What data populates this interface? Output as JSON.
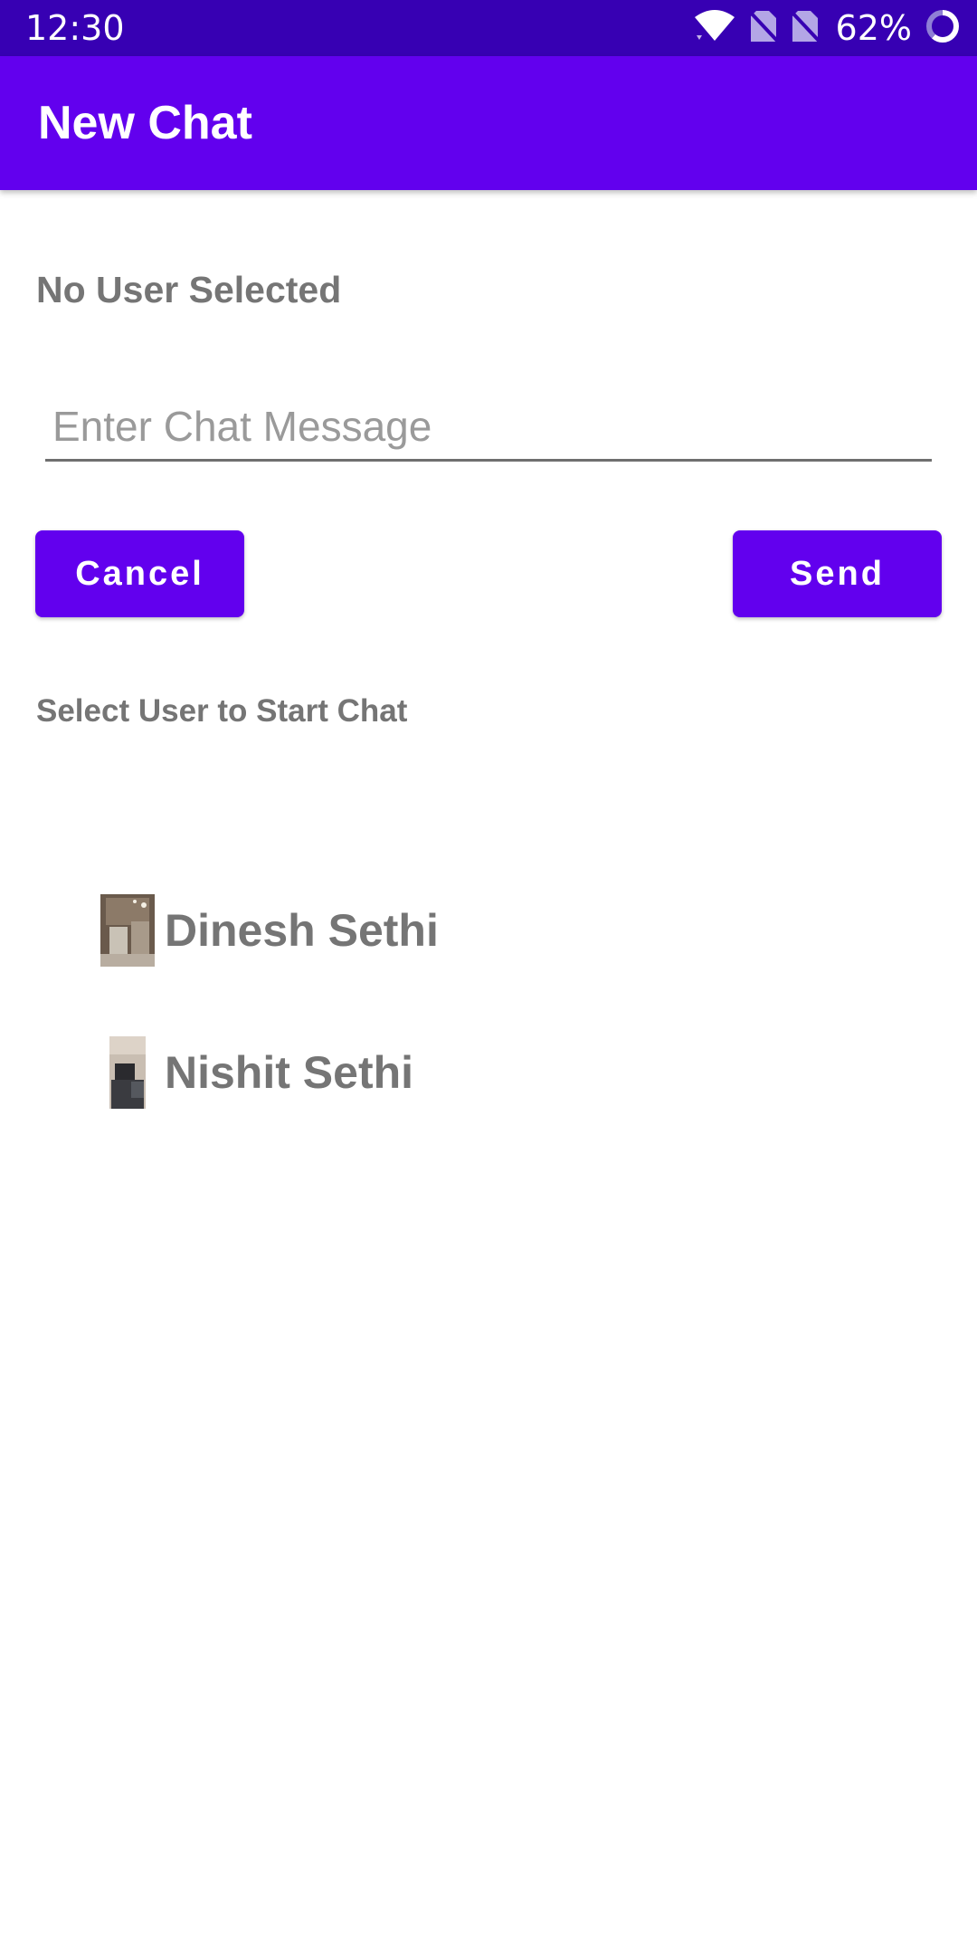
{
  "status_bar": {
    "time": "12:30",
    "battery": "62%",
    "icons": [
      "wifi-icon",
      "no-sim-icon",
      "no-sim-icon",
      "battery-circle-icon"
    ]
  },
  "app_bar": {
    "title": "New Chat"
  },
  "form": {
    "selected_user": "No User Selected",
    "message_placeholder": "Enter Chat Message",
    "message_value": "",
    "cancel_label": "Cancel",
    "send_label": "Send"
  },
  "users_section": {
    "label": "Select User to Start Chat",
    "users": [
      {
        "name": "Dinesh Sethi"
      },
      {
        "name": "Nishit Sethi"
      }
    ]
  },
  "colors": {
    "status_bar": "#3700b3",
    "primary": "#6200ee",
    "text_secondary": "#757575"
  }
}
